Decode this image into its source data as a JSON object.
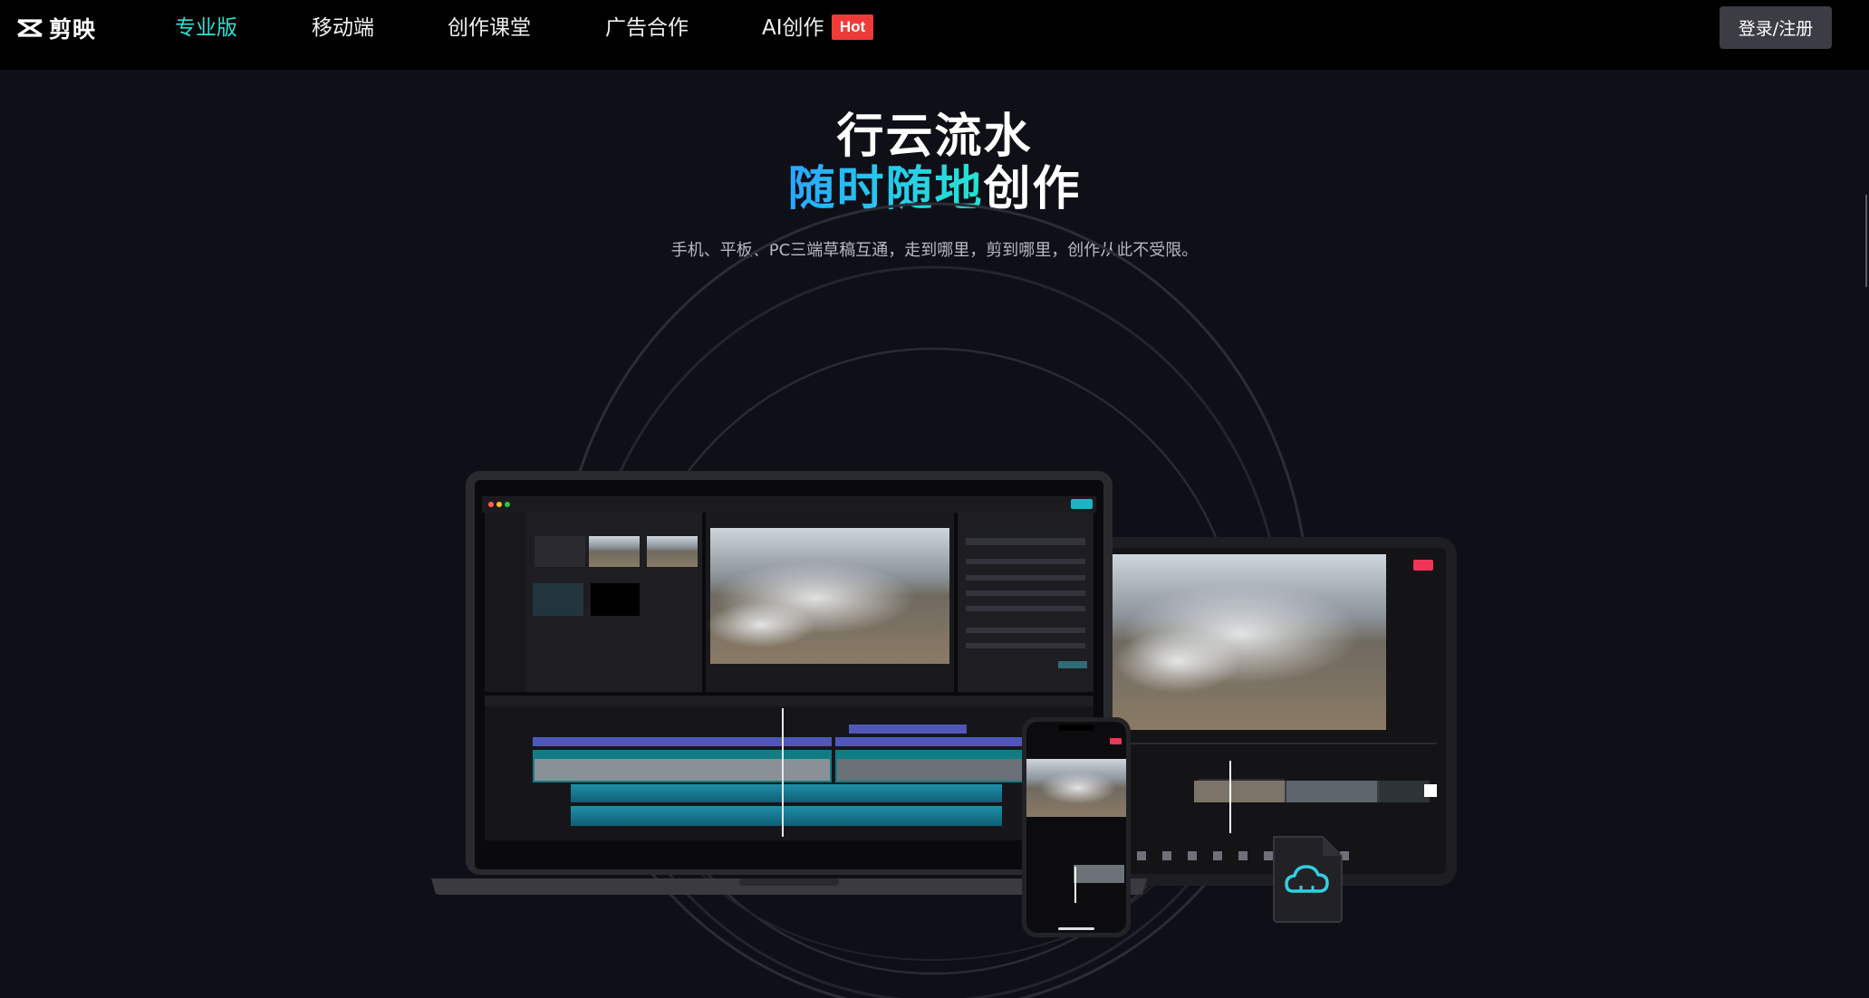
{
  "brand": {
    "name": "剪映",
    "logo_icon": "capcut-logo-icon"
  },
  "nav": {
    "items": [
      {
        "label": "专业版",
        "active": true
      },
      {
        "label": "移动端",
        "active": false
      },
      {
        "label": "创作课堂",
        "active": false
      },
      {
        "label": "广告合作",
        "active": false
      },
      {
        "label": "AI创作",
        "active": false
      }
    ],
    "badge": "Hot",
    "login_label": "登录/注册"
  },
  "hero": {
    "title_line1": "行云流水",
    "title_line2_highlight": "随时随地",
    "title_line2_rest": "创作",
    "subtitle": "手机、平板、PC三端草稿互通，走到哪里，剪到哪里，创作从此不受限。"
  },
  "colors": {
    "accent": "#2ee0d2",
    "hot": "#ef3b38",
    "background": "#0f0f17",
    "gradient_start": "#2aa6ff",
    "gradient_end": "#24e3cf"
  },
  "icons": [
    "cloud-sync-icon",
    "capcut-logo-icon"
  ]
}
